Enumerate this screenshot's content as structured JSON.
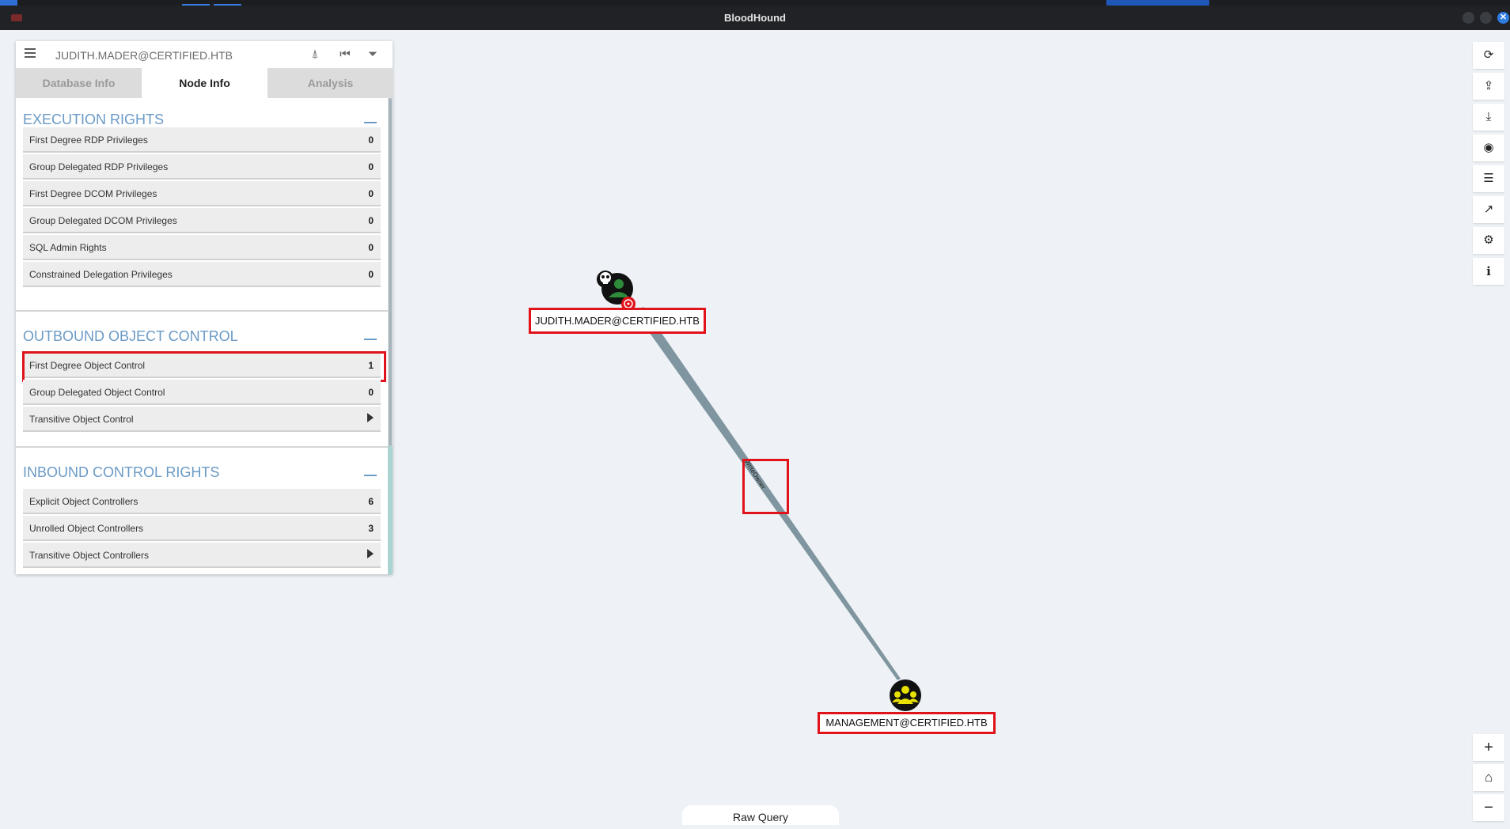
{
  "window": {
    "title": "BloodHound"
  },
  "search": {
    "value": "JUDITH.MADER@CERTIFIED.HTB"
  },
  "tabs": [
    {
      "label": "Database Info",
      "active": false
    },
    {
      "label": "Node Info",
      "active": true
    },
    {
      "label": "Analysis",
      "active": false
    }
  ],
  "sections": {
    "execution": {
      "title": "EXECUTION RIGHTS",
      "rows": [
        {
          "label": "First Degree RDP Privileges",
          "value": "0"
        },
        {
          "label": "Group Delegated RDP Privileges",
          "value": "0"
        },
        {
          "label": "First Degree DCOM Privileges",
          "value": "0"
        },
        {
          "label": "Group Delegated DCOM Privileges",
          "value": "0"
        },
        {
          "label": "SQL Admin Rights",
          "value": "0"
        },
        {
          "label": "Constrained Delegation Privileges",
          "value": "0"
        }
      ]
    },
    "outbound": {
      "title": "OUTBOUND OBJECT CONTROL",
      "rows": [
        {
          "label": "First Degree Object Control",
          "value": "1"
        },
        {
          "label": "Group Delegated Object Control",
          "value": "0"
        },
        {
          "label": "Transitive Object Control",
          "value": ""
        }
      ]
    },
    "inbound": {
      "title": "INBOUND CONTROL RIGHTS",
      "rows": [
        {
          "label": "Explicit Object Controllers",
          "value": "6"
        },
        {
          "label": "Unrolled Object Controllers",
          "value": "3"
        },
        {
          "label": "Transitive Object Controllers",
          "value": ""
        }
      ]
    }
  },
  "graph": {
    "source_node": "JUDITH.MADER@CERTIFIED.HTB",
    "target_node": "MANAGEMENT@CERTIFIED.HTB",
    "edge_label": "WriteOwner"
  },
  "raw_query": {
    "label": "Raw Query"
  },
  "colors": {
    "highlight": "#e0121a",
    "section_title": "#6a9ac6",
    "edge": "#7f959f",
    "user_node": "#2e8b3a",
    "group_node": "#e8e000"
  },
  "icons": {
    "toolbar": [
      "refresh-icon",
      "upload-icon",
      "download-icon",
      "target-icon",
      "tasks-icon",
      "chart-icon",
      "settings-icon",
      "info-icon"
    ],
    "zoom": [
      "zoom-in-icon",
      "home-icon",
      "zoom-out-icon"
    ]
  }
}
